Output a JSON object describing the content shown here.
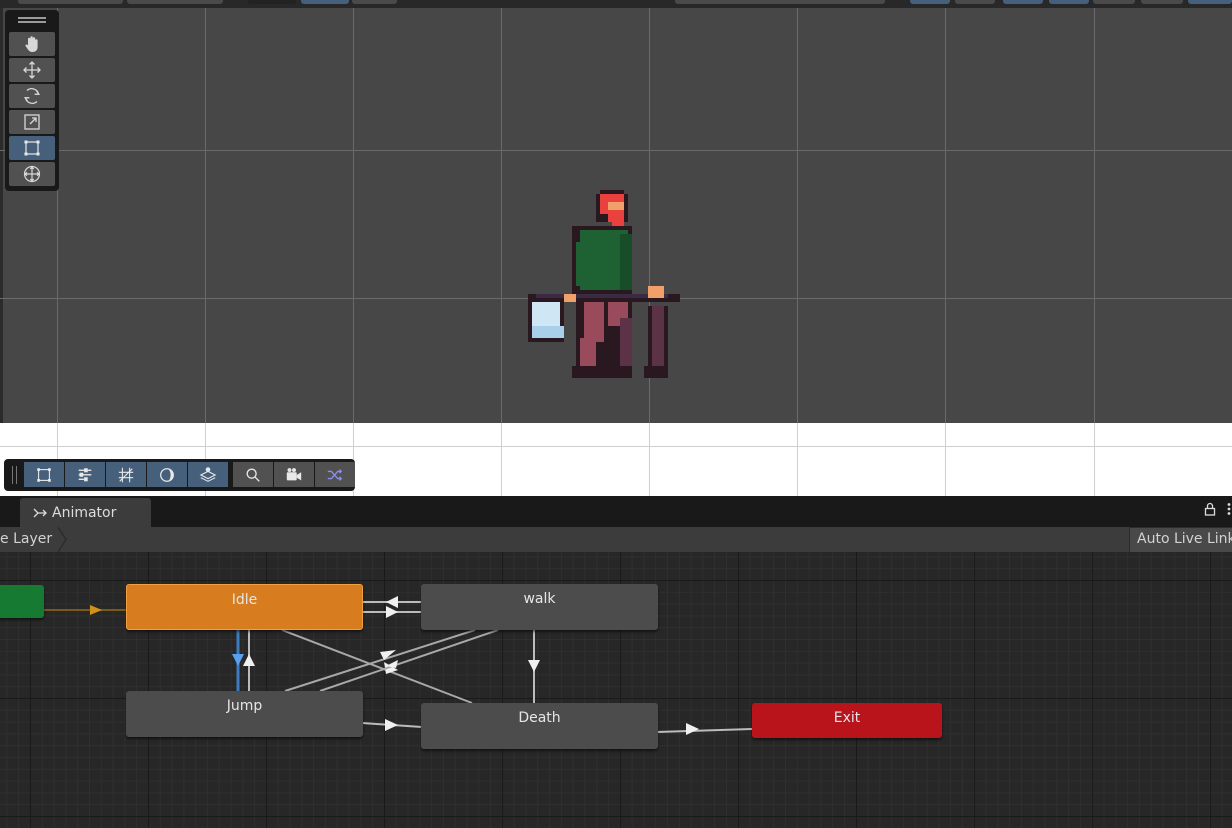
{
  "scene": {
    "tools": [
      "hand-tool",
      "move-tool",
      "rotate-tool",
      "scale-tool",
      "rect-tool",
      "transform-tool"
    ],
    "active_tool_index": 4,
    "overlay_buttons": [
      "rect-icon",
      "sliders-icon",
      "grid-hatch-icon",
      "shading-icon",
      "layers-icon",
      "search-icon",
      "camera-icon",
      "shuffle-icon"
    ]
  },
  "animator": {
    "tab_label": "Animator",
    "breadcrumb": "e Layer",
    "auto_live_link": "Auto Live Link",
    "states": {
      "idle": "Idle",
      "walk": "walk",
      "jump": "Jump",
      "death": "Death",
      "exit": "Exit"
    }
  },
  "colors": {
    "idle_state": "#d77c1f",
    "entry_state": "#167a33",
    "exit_state": "#b9141b",
    "normal_state": "#4c4c4c",
    "active_tool": "#46607c"
  }
}
